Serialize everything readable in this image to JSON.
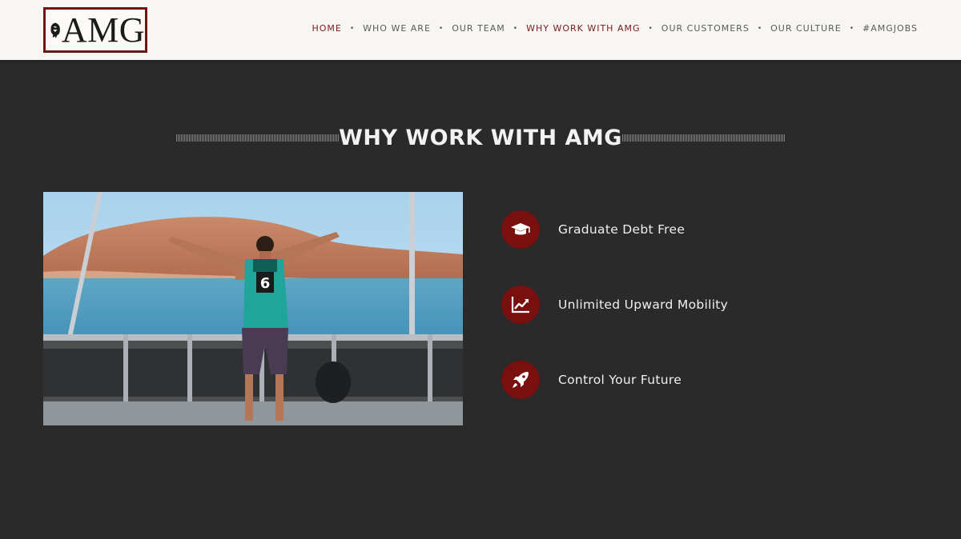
{
  "header": {
    "logo_text": "AMG",
    "nav": [
      {
        "label": "HOME",
        "active": true
      },
      {
        "label": "WHO WE ARE",
        "active": false
      },
      {
        "label": "OUR TEAM",
        "active": false
      },
      {
        "label": "WHY WORK WITH AMG",
        "active": true
      },
      {
        "label": "OUR CUSTOMERS",
        "active": false
      },
      {
        "label": "OUR CULTURE",
        "active": false
      },
      {
        "label": "#AMGJOBS",
        "active": false
      }
    ],
    "separator": "•"
  },
  "section": {
    "title": "WHY WORK WITH AMG"
  },
  "photo": {
    "jersey_number": "6"
  },
  "features": [
    {
      "label": "Graduate Debt Free",
      "icon": "graduation-cap-icon"
    },
    {
      "label": "Unlimited Upward Mobility",
      "icon": "line-chart-icon"
    },
    {
      "label": "Control Your Future",
      "icon": "rocket-icon"
    }
  ],
  "colors": {
    "brand": "#7a0f0f",
    "background": "#2a2a2a",
    "header_bg": "#f7f6f2",
    "active_nav": "#7a1a1a"
  }
}
